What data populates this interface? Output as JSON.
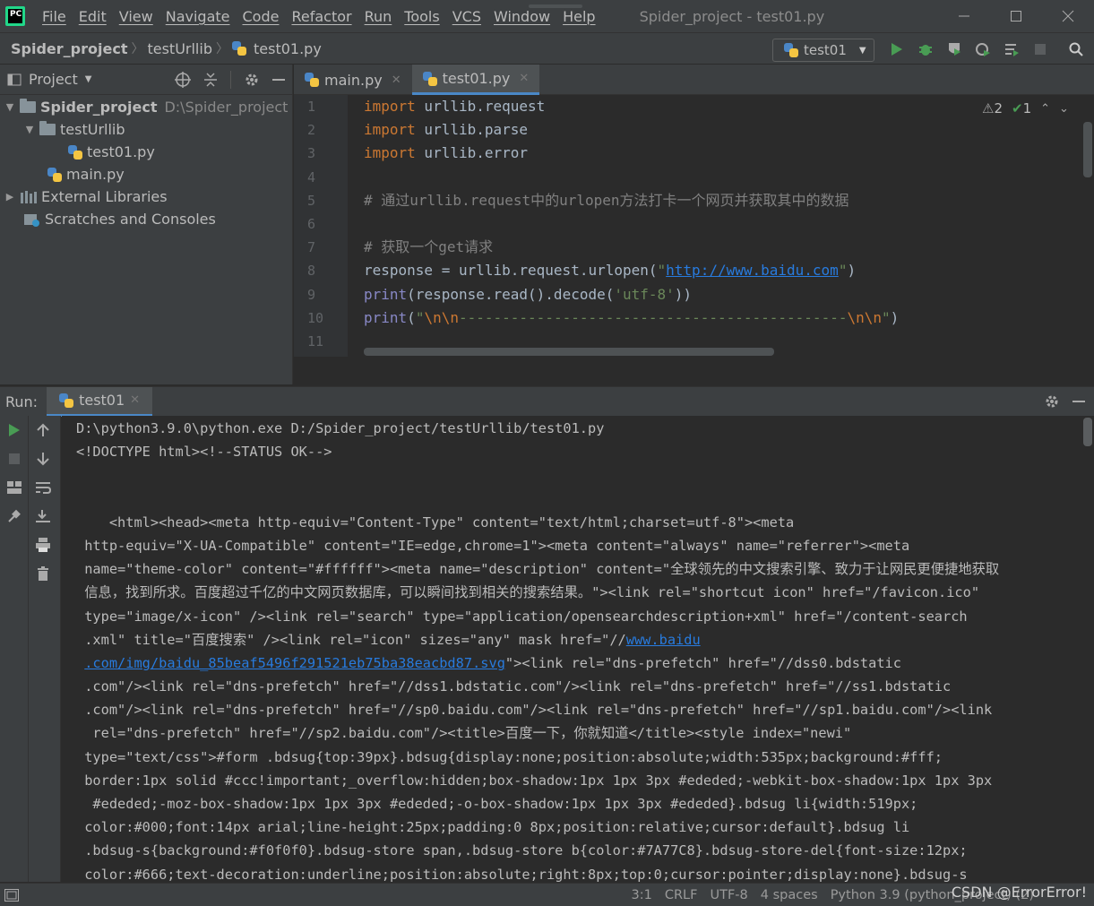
{
  "menubar": {
    "items": [
      "File",
      "Edit",
      "View",
      "Navigate",
      "Code",
      "Refactor",
      "Run",
      "Tools",
      "VCS",
      "Window",
      "Help"
    ],
    "window_title": "Spider_project - test01.py"
  },
  "navbar": {
    "breadcrumbs": [
      "Spider_project",
      "testUrllib",
      "test01.py"
    ],
    "run_config": "test01"
  },
  "project_panel": {
    "title": "Project",
    "tree": [
      {
        "label": "Spider_project",
        "path": "D:\\Spider_project"
      },
      {
        "label": "testUrllib"
      },
      {
        "label": "test01.py"
      },
      {
        "label": "main.py"
      },
      {
        "label": "External Libraries"
      },
      {
        "label": "Scratches and Consoles"
      }
    ]
  },
  "editor": {
    "tabs": [
      "main.py",
      "test01.py"
    ],
    "inspections": {
      "warnings": "2",
      "ok": "1"
    },
    "line_numbers": [
      "1",
      "2",
      "3",
      "4",
      "5",
      "6",
      "7",
      "8",
      "9",
      "10",
      "11"
    ],
    "lines": [
      {
        "kw": "import",
        "rest": " urllib.request"
      },
      {
        "kw": "import",
        "rest": " urllib.parse"
      },
      {
        "kw": "import",
        "rest": " urllib.error"
      },
      {
        "text": ""
      },
      {
        "comment": "# 通过urllib.request中的urlopen方法打卡一个网页并获取其中的数据"
      },
      {
        "text": ""
      },
      {
        "comment": "# 获取一个get请求"
      },
      {
        "pre": "response = urllib.request.urlopen(",
        "q1": "\"",
        "url": "http://www.baidu.com",
        "q2": "\"",
        "post": ")"
      },
      {
        "bi": "print",
        "pre": "(response.read().decode(",
        "str": "'utf-8'",
        "post": "))"
      },
      {
        "bi": "print",
        "pre": "(",
        "s1": "\"",
        "esc1": "\\n\\n",
        "s2": "---------------------------------------------",
        "esc2": "\\n\\n",
        "s3": "\"",
        "post": ")"
      },
      {
        "text": ""
      }
    ]
  },
  "run_panel": {
    "label": "Run:",
    "tab": "test01",
    "console": [
      "D:\\python3.9.0\\python.exe D:/Spider_project/testUrllib/test01.py",
      "<!DOCTYPE html><!--STATUS OK-->",
      "",
      "",
      "    <html><head><meta http-equiv=\"Content-Type\" content=\"text/html;charset=utf-8\"><meta",
      " http-equiv=\"X-UA-Compatible\" content=\"IE=edge,chrome=1\"><meta content=\"always\" name=\"referrer\"><meta",
      " name=\"theme-color\" content=\"#ffffff\"><meta name=\"description\" content=\"全球领先的中文搜索引擎、致力于让网民更便捷地获取",
      " 信息，找到所求。百度超过千亿的中文网页数据库，可以瞬间找到相关的搜索结果。\"><link rel=\"shortcut icon\" href=\"/favicon.ico\"",
      " type=\"image/x-icon\" /><link rel=\"search\" type=\"application/opensearchdescription+xml\" href=\"/content-search",
      " .xml\" title=\"百度搜索\" /><link rel=\"icon\" sizes=\"any\" mask href=\"//",
      "",
      " .com\"/><link rel=\"dns-prefetch\" href=\"//dss1.bdstatic.com\"/><link rel=\"dns-prefetch\" href=\"//ss1.bdstatic",
      " .com\"/><link rel=\"dns-prefetch\" href=\"//sp0.baidu.com\"/><link rel=\"dns-prefetch\" href=\"//sp1.baidu.com\"/><link",
      "  rel=\"dns-prefetch\" href=\"//sp2.baidu.com\"/><title>百度一下，你就知道</title><style index=\"newi\"",
      " type=\"text/css\">#form .bdsug{top:39px}.bdsug{display:none;position:absolute;width:535px;background:#fff;",
      " border:1px solid #ccc!important;_overflow:hidden;box-shadow:1px 1px 3px #ededed;-webkit-box-shadow:1px 1px 3px",
      "  #ededed;-moz-box-shadow:1px 1px 3px #ededed;-o-box-shadow:1px 1px 3px #ededed}.bdsug li{width:519px;",
      " color:#000;font:14px arial;line-height:25px;padding:0 8px;position:relative;cursor:default}.bdsug li",
      " .bdsug-s{background:#f0f0f0}.bdsug-store span,.bdsug-store b{color:#7A77C8}.bdsug-store-del{font-size:12px;",
      " color:#666;text-decoration:underline;position:absolute;right:8px;top:0;cursor:pointer;display:none}.bdsug-s"
    ],
    "console_link1": "www.baidu",
    "console_link2": ".com/img/baidu_85beaf5496f291521eb75ba38eacbd87.svg",
    "console_link2_tail": "\"><link rel=\"dns-prefetch\" href=\"//dss0.bdstatic"
  },
  "statusbar": {
    "position": "3:1",
    "line_sep": "CRLF",
    "encoding": "UTF-8",
    "indent": "4 spaces",
    "interpreter": "Python 3.9 (python_project) (2)",
    "watermark": "CSDN @ErrorError!"
  },
  "colors": {
    "accent": "#4a88c7",
    "keyword": "#cc7832",
    "string": "#6a8759",
    "comment": "#808080",
    "link": "#287bde"
  }
}
